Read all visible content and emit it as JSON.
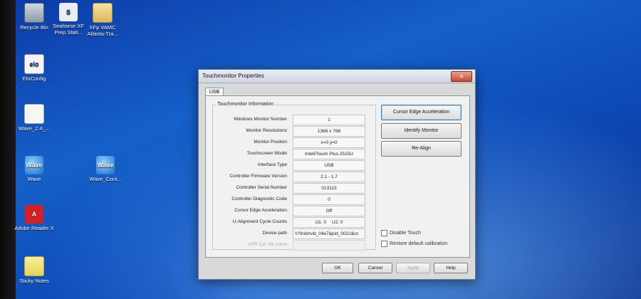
{
  "desktop": {
    "icons": [
      {
        "label": "Recycle Bin",
        "icon": "recycle-bin-icon"
      },
      {
        "label": "Seahorse XF Prep Stati...",
        "icon": "seahorse-icon"
      },
      {
        "label": "XFp VAMC Atlanta-Tra...",
        "icon": "folder-icon"
      },
      {
        "label": "EloConfig",
        "icon": "elo-icon"
      },
      {
        "label": "Wave_2.4_...",
        "icon": "pdf-file-icon"
      },
      {
        "label": "Wave",
        "icon": "wave-icon"
      },
      {
        "label": "Wave_Cont...",
        "icon": "wave-icon"
      },
      {
        "label": "Adobe Reader X",
        "icon": "adobe-reader-icon"
      },
      {
        "label": "Sticky Notes",
        "icon": "sticky-notes-icon"
      }
    ],
    "icon_glyphs": {
      "elo": "elo",
      "wave": "Wave",
      "seahorse": "S",
      "adobe": "A"
    }
  },
  "dialog": {
    "title": "Touchmonitor Properties",
    "close_glyph": "✕",
    "tab": "USB",
    "group_title": "Touchmonitor Information",
    "rows": [
      {
        "label": "Windows Monitor Number",
        "value": "1"
      },
      {
        "label": "Monitor Resolutions",
        "value": "1366 x 768"
      },
      {
        "label": "Monitor Position",
        "value": "x=0  y=0"
      },
      {
        "label": "Touchscreen Model",
        "value": "IntelliTouch Plus 2515U"
      },
      {
        "label": "Interface Type",
        "value": "USB"
      },
      {
        "label": "Controller Firmware Version",
        "value": "2.1 - 1.7"
      },
      {
        "label": "Controller Serial Number",
        "value": "013113"
      },
      {
        "label": "Controller Diagnostic Code",
        "value": "0"
      },
      {
        "label": "Cursor Edge Acceleration",
        "value": "Off"
      },
      {
        "label": "U-Alignment Cycle Counts",
        "value_a": "U1: 0",
        "value_b": "U2: 0"
      },
      {
        "label": "Device path",
        "value": "\\\\?\\hid#vid_04e7&pid_0022&cc"
      },
      {
        "label": "APR Cal. file name",
        "value": ""
      }
    ],
    "buttons": {
      "cursor_edge": "Cursor Edge Acceleration",
      "identify": "Identify Monitor",
      "realign": "Re-Align"
    },
    "checkboxes": {
      "disable_touch": "Disable Touch",
      "restore_default": "Restore default calibration"
    },
    "footer": {
      "ok": "OK",
      "cancel": "Cancel",
      "apply": "Apply",
      "help": "Help"
    }
  }
}
